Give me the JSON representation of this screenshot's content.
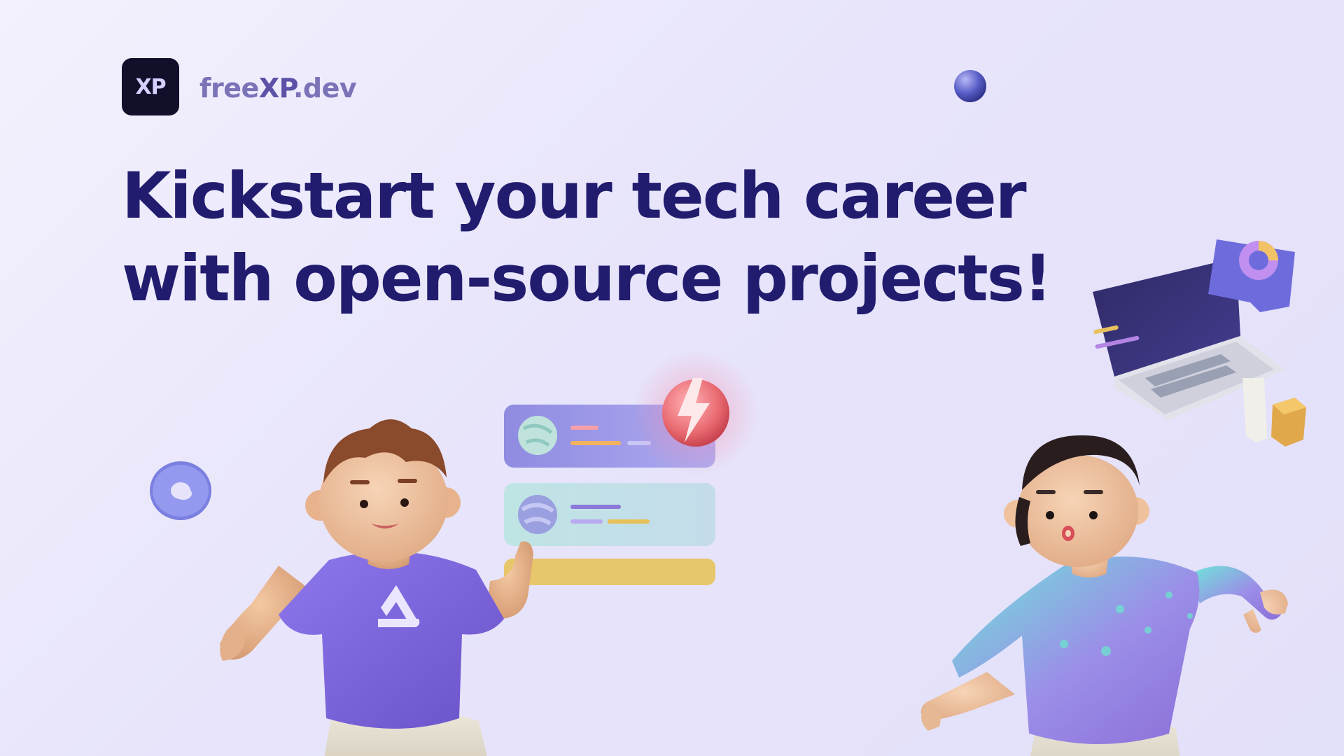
{
  "brand": {
    "logo_text": "XP",
    "name_prefix": "free",
    "name_xp": "XP",
    "name_suffix": ".dev"
  },
  "headline": {
    "line1": "Kickstart your tech career",
    "line2": "with open-source projects!"
  },
  "colors": {
    "background": "#e6e3fb",
    "headline": "#211c6e",
    "logo_bg": "#120f2a",
    "brand_text": "#7a73b8",
    "card_purple": "#9b95e0",
    "card_teal": "#bfe0e4",
    "bar_yellow": "#e8c66b",
    "shirt_purple": "#7b62d9",
    "hoodie_teal": "#7ee3d6"
  },
  "icons": [
    "sphere-icon",
    "torus-icon",
    "lightning-icon",
    "laptop-icon",
    "chart-icon",
    "cube-icon",
    "user-icon"
  ]
}
